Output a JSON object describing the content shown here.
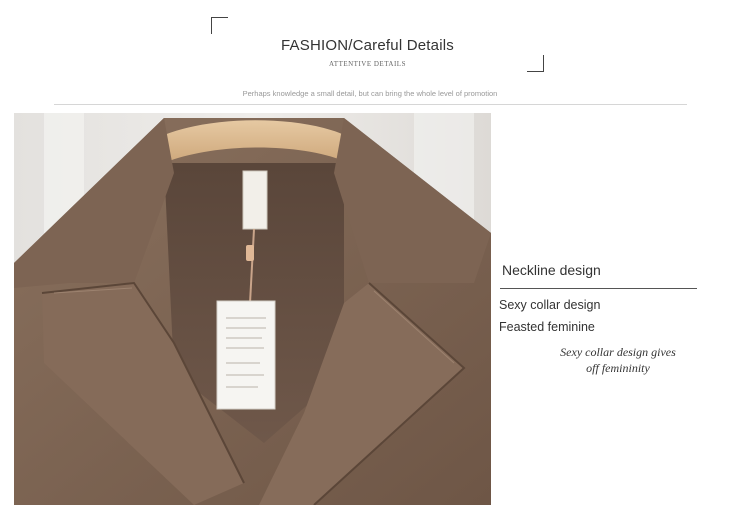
{
  "header": {
    "title": "FASHION/Careful Details",
    "subtitle": "ATTENTIVE DETAILS",
    "tagline": "Perhaps knowledge a small detail, but can bring the whole level of promotion"
  },
  "detail": {
    "heading": "Neckline design",
    "line1": "Sexy collar design",
    "line2": "Feasted feminine",
    "italic_line1": "Sexy collar design gives",
    "italic_line2": "off femininity"
  },
  "photo": {
    "subject": "brown trench coat collar on wooden hanger with hang tag"
  }
}
